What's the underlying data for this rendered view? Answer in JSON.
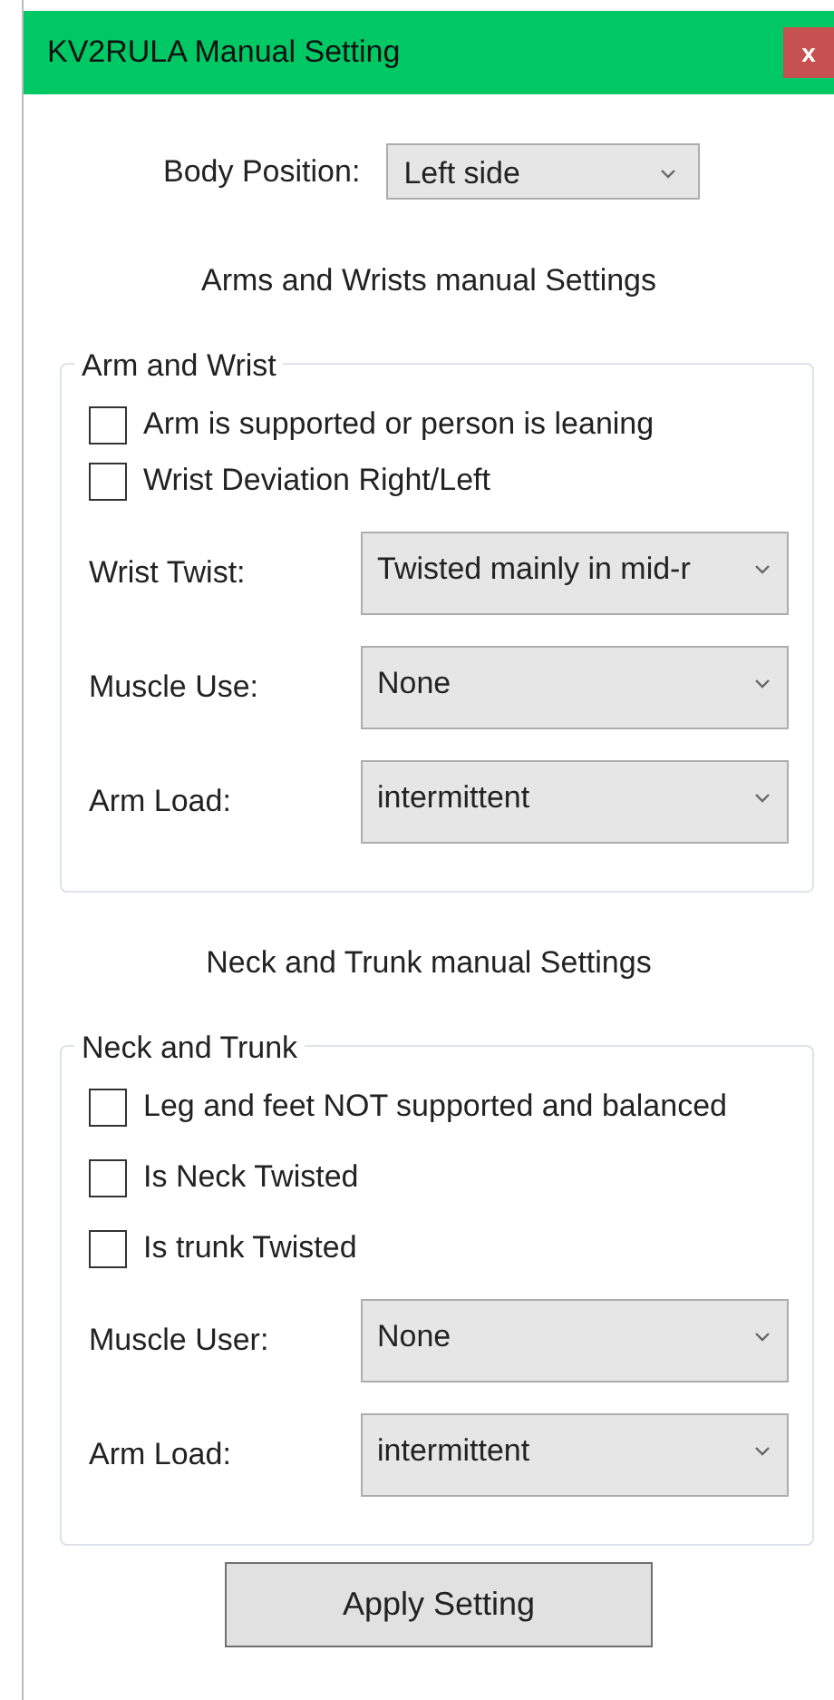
{
  "window": {
    "title": "KV2RULA Manual Setting",
    "close": "x"
  },
  "body_position": {
    "label": "Body Position:",
    "value": "Left side"
  },
  "sections": [
    {
      "heading": "Arms and Wrists manual Settings",
      "group": "Arm and Wrist",
      "checkboxes": [
        {
          "label": "Arm is supported or person is leaning",
          "checked": false
        },
        {
          "label": "Wrist Deviation Right/Left",
          "checked": false
        }
      ],
      "fields": [
        {
          "label": "Wrist Twist:",
          "value": "Twisted mainly in mid-r"
        },
        {
          "label": "Muscle Use:",
          "value": "None"
        },
        {
          "label": "Arm Load:",
          "value": "intermittent"
        }
      ]
    },
    {
      "heading": "Neck and Trunk manual Settings",
      "group": "Neck and Trunk",
      "checkboxes": [
        {
          "label": "Leg and feet NOT supported and balanced",
          "checked": false
        },
        {
          "label": "Is Neck Twisted",
          "checked": false
        },
        {
          "label": "Is trunk Twisted",
          "checked": false
        }
      ],
      "fields": [
        {
          "label": "Muscle User:",
          "value": "None"
        },
        {
          "label": "Arm Load:",
          "value": "intermittent"
        }
      ]
    }
  ],
  "apply_button": "Apply Setting"
}
